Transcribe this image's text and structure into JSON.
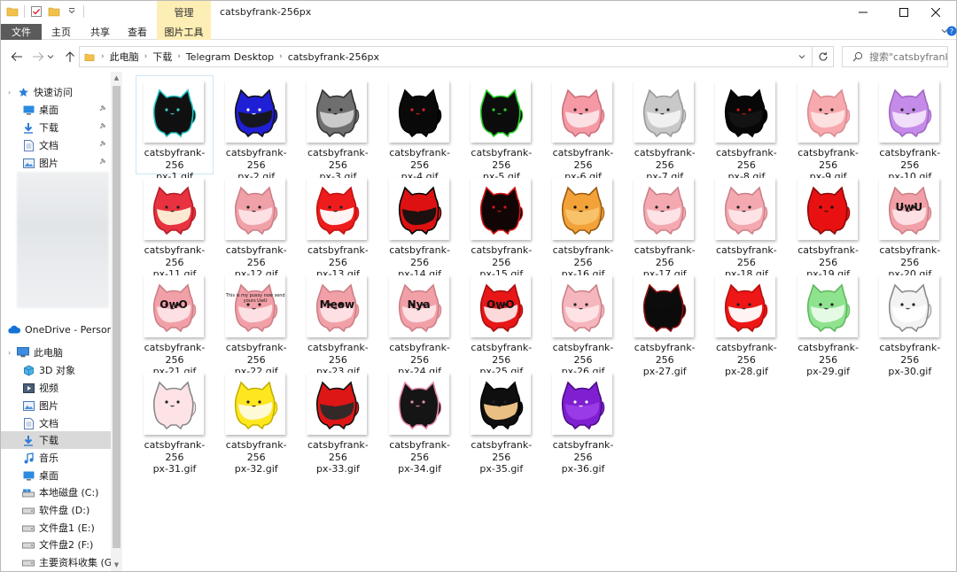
{
  "window": {
    "title": "catsbyfrank-256px",
    "manage_tab": "管理"
  },
  "ribbon": {
    "tabs": [
      "文件",
      "主页",
      "共享",
      "查看",
      "图片工具"
    ]
  },
  "address": {
    "crumbs": [
      "此电脑",
      "下载",
      "Telegram Desktop",
      "catsbyfrank-256px"
    ],
    "search_placeholder": "搜索\"catsbyfrank..."
  },
  "nav": {
    "quick_access": "快速访问",
    "quick_items": [
      "桌面",
      "下载",
      "文档",
      "图片"
    ],
    "onedrive": "OneDrive - Person",
    "this_pc": "此电脑",
    "pc_items": [
      "3D 对象",
      "视频",
      "图片",
      "文档",
      "下载",
      "音乐",
      "桌面",
      "本地磁盘 (C:)",
      "软件盘 (D:)",
      "文件盘1 (E:)",
      "文件盘2 (F:)",
      "主要资料收集 (G:)"
    ]
  },
  "files": [
    {
      "line1": "catsbyfrank-256",
      "line2": "px-1.gif",
      "body": "#111111",
      "face": "#111111",
      "outline": "#27c4c4",
      "eyes": "#3ad1c9",
      "caption": ""
    },
    {
      "line1": "catsbyfrank-256",
      "line2": "px-2.gif",
      "body": "#1f1fd6",
      "face": "#161616",
      "outline": "#111111",
      "eyes": "#ffffff",
      "caption": ""
    },
    {
      "line1": "catsbyfrank-256",
      "line2": "px-3.gif",
      "body": "#6f6f6f",
      "face": "#cfcfcf",
      "outline": "#333333",
      "eyes": "#111111",
      "caption": ""
    },
    {
      "line1": "catsbyfrank-256",
      "line2": "px-4.gif",
      "body": "#0a0a0a",
      "face": "#0a0a0a",
      "outline": "#000000",
      "eyes": "#e02020",
      "caption": ""
    },
    {
      "line1": "catsbyfrank-256",
      "line2": "px-5.gif",
      "body": "#0d0d0d",
      "face": "#0d0d0d",
      "outline": "#27d127",
      "eyes": "#27d127",
      "caption": ""
    },
    {
      "line1": "catsbyfrank-256",
      "line2": "px-6.gif",
      "body": "#f59aa5",
      "face": "#fbe3e6",
      "outline": "#c9707b",
      "eyes": "#222222",
      "caption": ""
    },
    {
      "line1": "catsbyfrank-256",
      "line2": "px-7.gif",
      "body": "#c8c8c8",
      "face": "#f2f2f2",
      "outline": "#9a9a9a",
      "eyes": "#222222",
      "caption": ""
    },
    {
      "line1": "catsbyfrank-256",
      "line2": "px-8.gif",
      "body": "#080808",
      "face": "#141414",
      "outline": "#000000",
      "eyes": "#d01818",
      "caption": ""
    },
    {
      "line1": "catsbyfrank-256",
      "line2": "px-9.gif",
      "body": "#f7a9ae",
      "face": "#fde3e3",
      "outline": "#d88b91",
      "eyes": "#222222",
      "caption": ""
    },
    {
      "line1": "catsbyfrank-256",
      "line2": "px-10.gif",
      "body": "#c58be8",
      "face": "#f3e3fb",
      "outline": "#a067c4",
      "eyes": "#222222",
      "caption": ""
    },
    {
      "line1": "catsbyfrank-256",
      "line2": "px-11.gif",
      "body": "#e8323f",
      "face": "#fdf3d9",
      "outline": "#b51d28",
      "eyes": "#222222",
      "caption": ""
    },
    {
      "line1": "catsbyfrank-256",
      "line2": "px-12.gif",
      "body": "#f0a1a8",
      "face": "#fde4e6",
      "outline": "#cc7f86",
      "eyes": "#222222",
      "caption": ""
    },
    {
      "line1": "catsbyfrank-256",
      "line2": "px-13.gif",
      "body": "#ee1c1c",
      "face": "#ffffff",
      "outline": "#c21212",
      "eyes": "#222222",
      "caption": ""
    },
    {
      "line1": "catsbyfrank-256",
      "line2": "px-14.gif",
      "body": "#dd1111",
      "face": "#111111",
      "outline": "#000000",
      "eyes": "#dd1111",
      "caption": ""
    },
    {
      "line1": "catsbyfrank-256",
      "line2": "px-15.gif",
      "body": "#120505",
      "face": "#120505",
      "outline": "#d01818",
      "eyes": "#d01818",
      "caption": ""
    },
    {
      "line1": "catsbyfrank-256",
      "line2": "px-16.gif",
      "body": "#f3a23a",
      "face": "#f7c46d",
      "outline": "#9a5b10",
      "eyes": "#111111",
      "caption": ""
    },
    {
      "line1": "catsbyfrank-256",
      "line2": "px-17.gif",
      "body": "#f4a9b1",
      "face": "#fde6e8",
      "outline": "#cc8088",
      "eyes": "#222222",
      "caption": ""
    },
    {
      "line1": "catsbyfrank-256",
      "line2": "px-18.gif",
      "body": "#f4a9b1",
      "face": "#fde6e8",
      "outline": "#cc8088",
      "eyes": "#222222",
      "caption": ""
    },
    {
      "line1": "catsbyfrank-256",
      "line2": "px-19.gif",
      "body": "#e81111",
      "face": "#e81111",
      "outline": "#8a0a0a",
      "eyes": "#111111",
      "caption": ""
    },
    {
      "line1": "catsbyfrank-256",
      "line2": "px-20.gif",
      "body": "#f2a0a8",
      "face": "#fde4e6",
      "outline": "#cc7f86",
      "eyes": "#222222",
      "caption": "UwU"
    },
    {
      "line1": "catsbyfrank-256",
      "line2": "px-21.gif",
      "body": "#f2a0a8",
      "face": "#fde4e6",
      "outline": "#cc7f86",
      "eyes": "#222222",
      "caption": "OwO"
    },
    {
      "line1": "catsbyfrank-256",
      "line2": "px-22.gif",
      "body": "#f2a0a8",
      "face": "#fde4e6",
      "outline": "#cc7f86",
      "eyes": "#222222",
      "caption": "This is my pussy now send yours UwU"
    },
    {
      "line1": "catsbyfrank-256",
      "line2": "px-23.gif",
      "body": "#f2a0a8",
      "face": "#fde4e6",
      "outline": "#cc7f86",
      "eyes": "#222222",
      "caption": "Meow"
    },
    {
      "line1": "catsbyfrank-256",
      "line2": "px-24.gif",
      "body": "#f2a0a8",
      "face": "#fde4e6",
      "outline": "#cc7f86",
      "eyes": "#222222",
      "caption": "Nya"
    },
    {
      "line1": "catsbyfrank-256",
      "line2": "px-25.gif",
      "body": "#e81616",
      "face": "#fde4e6",
      "outline": "#a80e0e",
      "eyes": "#222222",
      "caption": "OwO"
    },
    {
      "line1": "catsbyfrank-256",
      "line2": "px-26.gif",
      "body": "#f5b6bd",
      "face": "#fde6e8",
      "outline": "#cc8088",
      "eyes": "#222222",
      "caption": ""
    },
    {
      "line1": "catsbyfrank-256",
      "line2": "px-27.gif",
      "body": "#0c0c0c",
      "face": "#0c0c0c",
      "outline": "#8a1010",
      "eyes": "#0c0c0c",
      "caption": ""
    },
    {
      "line1": "catsbyfrank-256",
      "line2": "px-28.gif",
      "body": "#ee1616",
      "face": "#ffffff",
      "outline": "#b51010",
      "eyes": "#222222",
      "caption": ""
    },
    {
      "line1": "catsbyfrank-256",
      "line2": "px-29.gif",
      "body": "#8fe38f",
      "face": "#e9fbe9",
      "outline": "#5fb85f",
      "eyes": "#222222",
      "caption": ""
    },
    {
      "line1": "catsbyfrank-256",
      "line2": "px-30.gif",
      "body": "#f3f3f3",
      "face": "#ffffff",
      "outline": "#8a8a8a",
      "eyes": "#222222",
      "caption": ""
    },
    {
      "line1": "catsbyfrank-256",
      "line2": "px-31.gif",
      "body": "#fde3e6",
      "face": "#fde3e6",
      "outline": "#8a8a8a",
      "eyes": "#222222",
      "caption": ""
    },
    {
      "line1": "catsbyfrank-256",
      "line2": "px-32.gif",
      "body": "#ffe71f",
      "face": "#fffbe0",
      "outline": "#c4b000",
      "eyes": "#222222",
      "caption": ""
    },
    {
      "line1": "catsbyfrank-256",
      "line2": "px-33.gif",
      "body": "#dd1616",
      "face": "#2a2a2a",
      "outline": "#111111",
      "eyes": "#dd1616",
      "caption": ""
    },
    {
      "line1": "catsbyfrank-256",
      "line2": "px-34.gif",
      "body": "#151515",
      "face": "#151515",
      "outline": "#e88bb0",
      "eyes": "#e88bb0",
      "caption": ""
    },
    {
      "line1": "catsbyfrank-256",
      "line2": "px-35.gif",
      "body": "#0f0f0f",
      "face": "#f6c98a",
      "outline": "#000000",
      "eyes": "#222222",
      "caption": ""
    },
    {
      "line1": "catsbyfrank-256",
      "line2": "px-36.gif",
      "body": "#7f1fd1",
      "face": "#9b3ee8",
      "outline": "#4b0d85",
      "eyes": "#ffffff",
      "caption": ""
    }
  ],
  "colors": {
    "selection": "#cde6f7",
    "nav_selected": "#d9d9d9",
    "picture_tools": "#fdeeb5",
    "file_tab": "#5b5b5b"
  }
}
